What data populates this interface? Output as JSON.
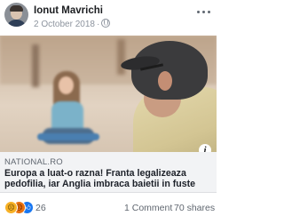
{
  "post": {
    "author": "Ionut Mavrichi",
    "date": "2 October 2018",
    "separator": "·",
    "privacy_icon": "globe-icon",
    "more_icon": "more-options-icon"
  },
  "link": {
    "source": "NATIONAL.RO",
    "headline": "Europa a luat-o razna! Franta legalizeaza pedofilia, iar Anglia imbraca baietii in fuste",
    "info_icon": "i"
  },
  "stats": {
    "reaction_icons": [
      "sad-icon",
      "angry-icon",
      "like-icon"
    ],
    "reaction_count": "26",
    "comments": "1 Comment",
    "shares": "70 shares"
  }
}
